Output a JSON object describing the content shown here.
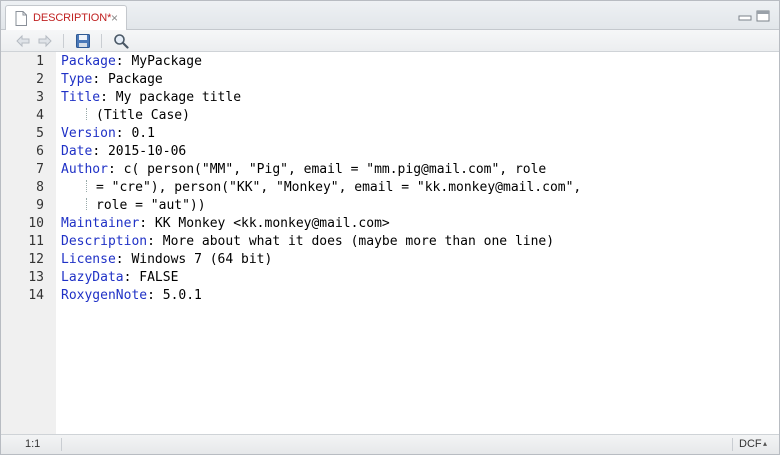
{
  "tab": {
    "label": "DESCRIPTION*",
    "close_label": "×",
    "icon": "document-icon"
  },
  "toolbar": {
    "icons": [
      "back-arrow-icon",
      "forward-arrow-icon",
      "save-icon",
      "search-icon"
    ]
  },
  "editor": {
    "lines": [
      {
        "n": "1",
        "key": "Package",
        "rest": ": MyPackage"
      },
      {
        "n": "2",
        "key": "Type",
        "rest": ": Package"
      },
      {
        "n": "3",
        "key": "Title",
        "rest": ": My package title"
      },
      {
        "n": "4",
        "key": "",
        "rest": "(Title Case)",
        "indent": true
      },
      {
        "n": "5",
        "key": "Version",
        "rest": ": 0.1"
      },
      {
        "n": "6",
        "key": "Date",
        "rest": ": 2015-10-06"
      },
      {
        "n": "7",
        "key": "Author",
        "rest": ": c( person(\"MM\", \"Pig\", email = \"mm.pig@mail.com\", role"
      },
      {
        "n": "8",
        "key": "",
        "rest": "= \"cre\"), person(\"KK\", \"Monkey\", email = \"kk.monkey@mail.com\",",
        "indent": true
      },
      {
        "n": "9",
        "key": "",
        "rest": "role = \"aut\"))",
        "indent": true
      },
      {
        "n": "10",
        "key": "Maintainer",
        "rest": ": KK Monkey <kk.monkey@mail.com>"
      },
      {
        "n": "11",
        "key": "Description",
        "rest": ": More about what it does (maybe more than one line)"
      },
      {
        "n": "12",
        "key": "License",
        "rest": ": Windows 7 (64 bit)"
      },
      {
        "n": "13",
        "key": "LazyData",
        "rest": ": FALSE"
      },
      {
        "n": "14",
        "key": "RoxygenNote",
        "rest": ": 5.0.1"
      }
    ]
  },
  "status": {
    "position": "1:1",
    "mode": "DCF",
    "mode_arrow": "▲▼"
  },
  "colors": {
    "key": "#1f31c6",
    "tab_label": "#c02222"
  }
}
